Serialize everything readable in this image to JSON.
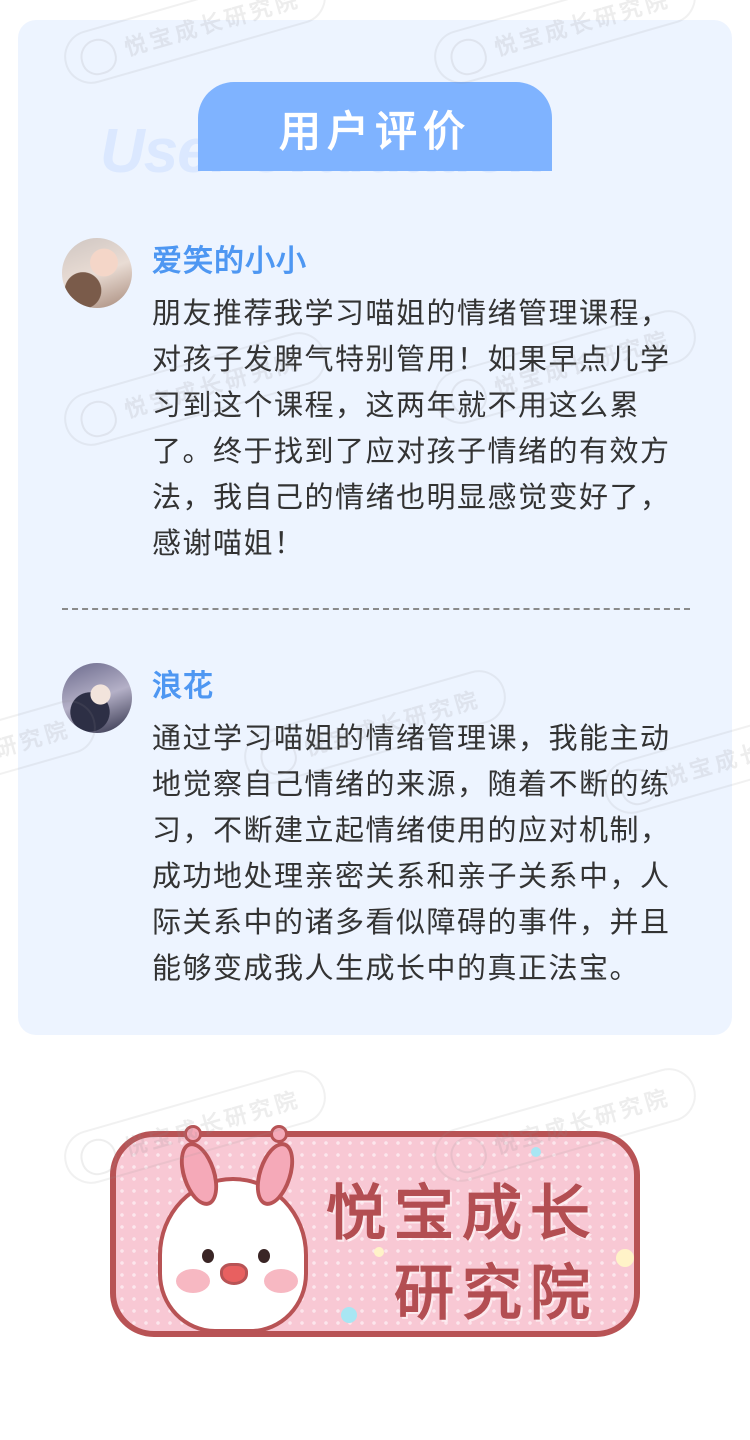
{
  "section": {
    "title": "用户评价",
    "title_en": "User evaluation"
  },
  "reviews": [
    {
      "name": "爱笑的小小",
      "text": "朋友推荐我学习喵姐的情绪管理课程，对孩子发脾气特别管用！如果早点儿学习到这个课程，这两年就不用这么累了。终于找到了应对孩子情绪的有效方法，我自己的情绪也明显感觉变好了，感谢喵姐！"
    },
    {
      "name": "浪花",
      "text": "通过学习喵姐的情绪管理课，我能主动地觉察自己情绪的来源，随着不断的练习，不断建立起情绪使用的应对机制，成功地处理亲密关系和亲子关系中，人际关系中的诸多看似障碍的事件，并且能够变成我人生成长中的真正法宝。"
    }
  ],
  "watermark": {
    "text": "悦宝成长研究院"
  },
  "logo": {
    "line1": "悦宝成长",
    "line2": "研究院"
  },
  "colors": {
    "card_bg": "#edf4ff",
    "title_tab": "#7fb3ff",
    "name": "#4e97f2",
    "text": "#333333",
    "logo_bg": "#f8c8d4",
    "logo_border": "#b85355"
  }
}
